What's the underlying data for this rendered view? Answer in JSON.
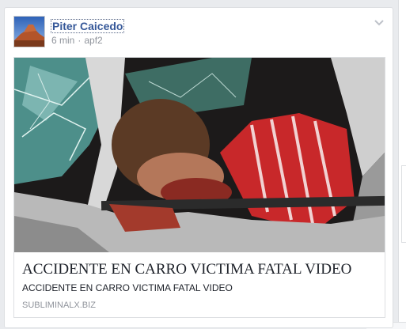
{
  "post": {
    "author": "Piter Caicedo",
    "time": "6 min",
    "via": "apf2"
  },
  "link": {
    "title": "ACCIDENTE EN CARRO VICTIMA FATAL VIDEO",
    "description": "ACCIDENTE EN CARRO VICTIMA FATAL VIDEO",
    "domain": "SUBLIMINALX.BIZ"
  },
  "icons": {
    "avatar": "landscape-photo-avatar",
    "menu": "chevron-down-icon"
  },
  "colors": {
    "author_link": "#365899",
    "meta_text": "#90949c",
    "page_bg": "#e9ebee"
  }
}
